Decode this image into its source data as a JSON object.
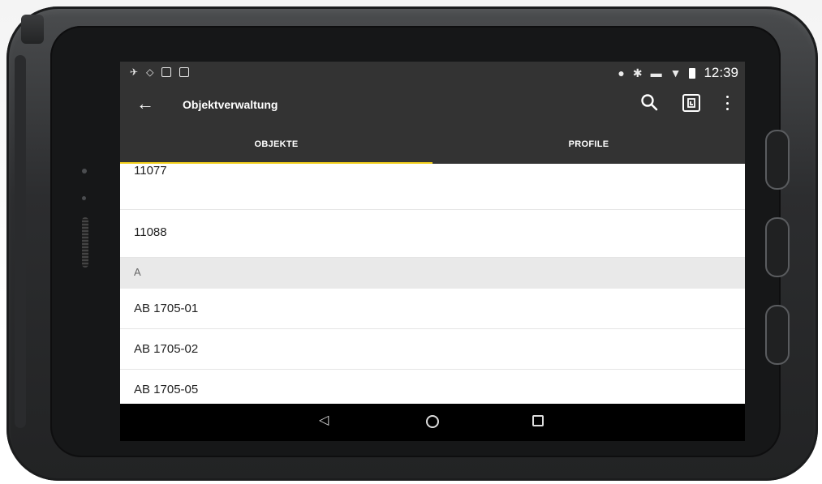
{
  "status_bar": {
    "time": "12:39",
    "left_icons": [
      "pin-crossed-icon",
      "shield-outline-icon",
      "download-box-icon",
      "image-icon"
    ],
    "right_icons": [
      "location-icon",
      "bluetooth-icon",
      "car-icon",
      "wifi-icon",
      "battery-icon"
    ]
  },
  "app_bar": {
    "title": "Objektverwaltung",
    "back_icon": "arrow-left-icon",
    "actions": [
      "search-icon",
      "nfc-icon",
      "more-vert-icon"
    ]
  },
  "tabs": [
    {
      "label": "OBJEKTE",
      "active": true
    },
    {
      "label": "PROFILE",
      "active": false
    }
  ],
  "colors": {
    "toolbar": "#333333",
    "indicator": "#f2cf1b",
    "section_bg": "#e9e9e9"
  },
  "list": {
    "rows": [
      {
        "type": "item",
        "label": "11077"
      },
      {
        "type": "item",
        "label": "11088"
      },
      {
        "type": "section",
        "label": "A"
      },
      {
        "type": "item",
        "label": "AB 1705-01"
      },
      {
        "type": "item",
        "label": "AB 1705-02"
      },
      {
        "type": "item",
        "label": "AB 1705-05"
      }
    ]
  },
  "nav_bar": [
    "back-triangle-icon",
    "home-circle-icon",
    "recents-square-icon"
  ]
}
